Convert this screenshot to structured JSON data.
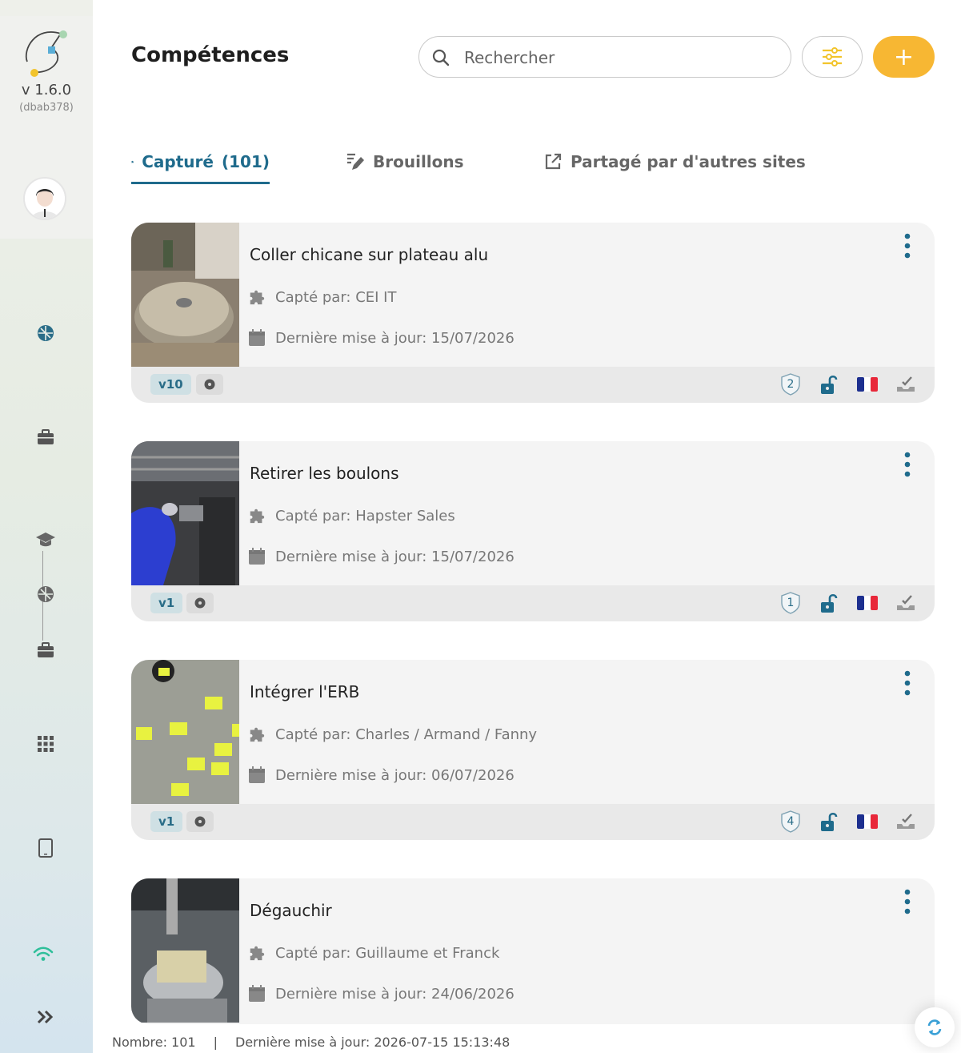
{
  "app": {
    "version": "v 1.6.0",
    "build": "(dbab378)"
  },
  "header": {
    "title": "Compétences",
    "search_placeholder": "Rechercher",
    "add_label": "+"
  },
  "tabs": [
    {
      "label": "Capturé",
      "count": "(101)",
      "icon": "puzzle-icon",
      "active": true
    },
    {
      "label": "Brouillons",
      "count": "",
      "icon": "edit-icon",
      "active": false
    },
    {
      "label": "Partagé par d'autres sites",
      "count": "",
      "icon": "external-link-icon",
      "active": false
    }
  ],
  "cards": [
    {
      "title": "Coller chicane sur plateau alu",
      "captured_by": "Capté par: CEI IT",
      "updated": "Dernière mise à jour: 15/07/2026",
      "version": "v10",
      "level": "2",
      "language": "fr-flag"
    },
    {
      "title": "Retirer les boulons",
      "captured_by": "Capté par: Hapster Sales",
      "updated": "Dernière mise à jour: 15/07/2026",
      "version": "v1",
      "level": "1",
      "language": "fr-flag"
    },
    {
      "title": "Intégrer l'ERB",
      "captured_by": "Capté par: Charles / Armand / Fanny",
      "updated": "Dernière mise à jour: 06/07/2026",
      "version": "v1",
      "level": "4",
      "language": "fr-flag"
    },
    {
      "title": "Dégauchir",
      "captured_by": "Capté par: Guillaume et Franck",
      "updated": "Dernière mise à jour: 24/06/2026",
      "version": "",
      "level": "",
      "language": "fr-flag"
    }
  ],
  "status": {
    "count": "Nombre: 101",
    "separator": "|",
    "last_update": "Dernière mise à jour: 2026-07-15 15:13:48"
  },
  "colors": {
    "accent": "#1f6b8c",
    "add_button": "#f7b733",
    "wifi": "#2fbf9a"
  }
}
